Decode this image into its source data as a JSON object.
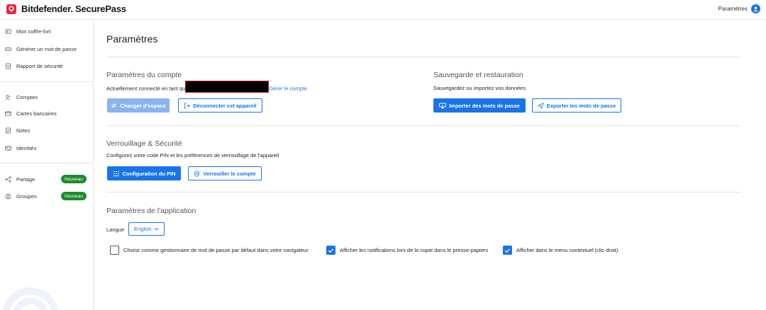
{
  "header": {
    "brand_name": "Bitdefender.",
    "brand_product": "SecurePass",
    "settings_label": "Paramètres",
    "accent": "#1a73e8",
    "brand_color": "#e5283b"
  },
  "sidebar": {
    "items": [
      {
        "label": "Mon coffre-fort",
        "icon": "vault-icon"
      },
      {
        "label": "Générer un mot de passe",
        "icon": "password-generator-icon"
      },
      {
        "label": "Rapport de sécurité",
        "icon": "report-icon"
      },
      {
        "label": "Comptes",
        "icon": "accounts-icon"
      },
      {
        "label": "Cartes bancaires",
        "icon": "card-icon"
      },
      {
        "label": "Notes",
        "icon": "note-icon"
      },
      {
        "label": "Identités",
        "icon": "identity-icon"
      },
      {
        "label": "Partage",
        "icon": "share-icon",
        "badge": "Nouveau"
      },
      {
        "label": "Groupes",
        "icon": "groups-icon",
        "badge": "Nouveau"
      }
    ],
    "badge_color": "#1f8a2d"
  },
  "main": {
    "title": "Paramètres",
    "account": {
      "title": "Paramètres du compte",
      "desc_prefix": "Actuellement connecté en tant qu",
      "manage_link": "Gérer le compte",
      "switch_space": "Changer d'espace",
      "disconnect": "Déconnecter cet appareil"
    },
    "backup": {
      "title": "Sauvegarde et restauration",
      "desc": "Sauvegardez ou importez vos données",
      "import": "Importer des mots de passe",
      "export": "Exporter les mots de passe"
    },
    "lock": {
      "title": "Verrouillage & Sécurité",
      "desc": "Configurez votre code PIN et les préférences de verrouillage de l'appareil",
      "pin": "Configuration du PIN",
      "lock_account": "Verrouiller le compte"
    },
    "app": {
      "title": "Paramètres de l'application",
      "language_label": "Langue",
      "language_value": "English",
      "options": [
        {
          "label": "Choisir comme gestionnaire de mot de passe par défaut dans votre navigateur",
          "checked": false
        },
        {
          "label": "Afficher les notifications lors de la copie dans le presse-papiers",
          "checked": true
        },
        {
          "label": "Afficher dans le menu contextuel (clic droit)",
          "checked": true
        }
      ]
    }
  }
}
